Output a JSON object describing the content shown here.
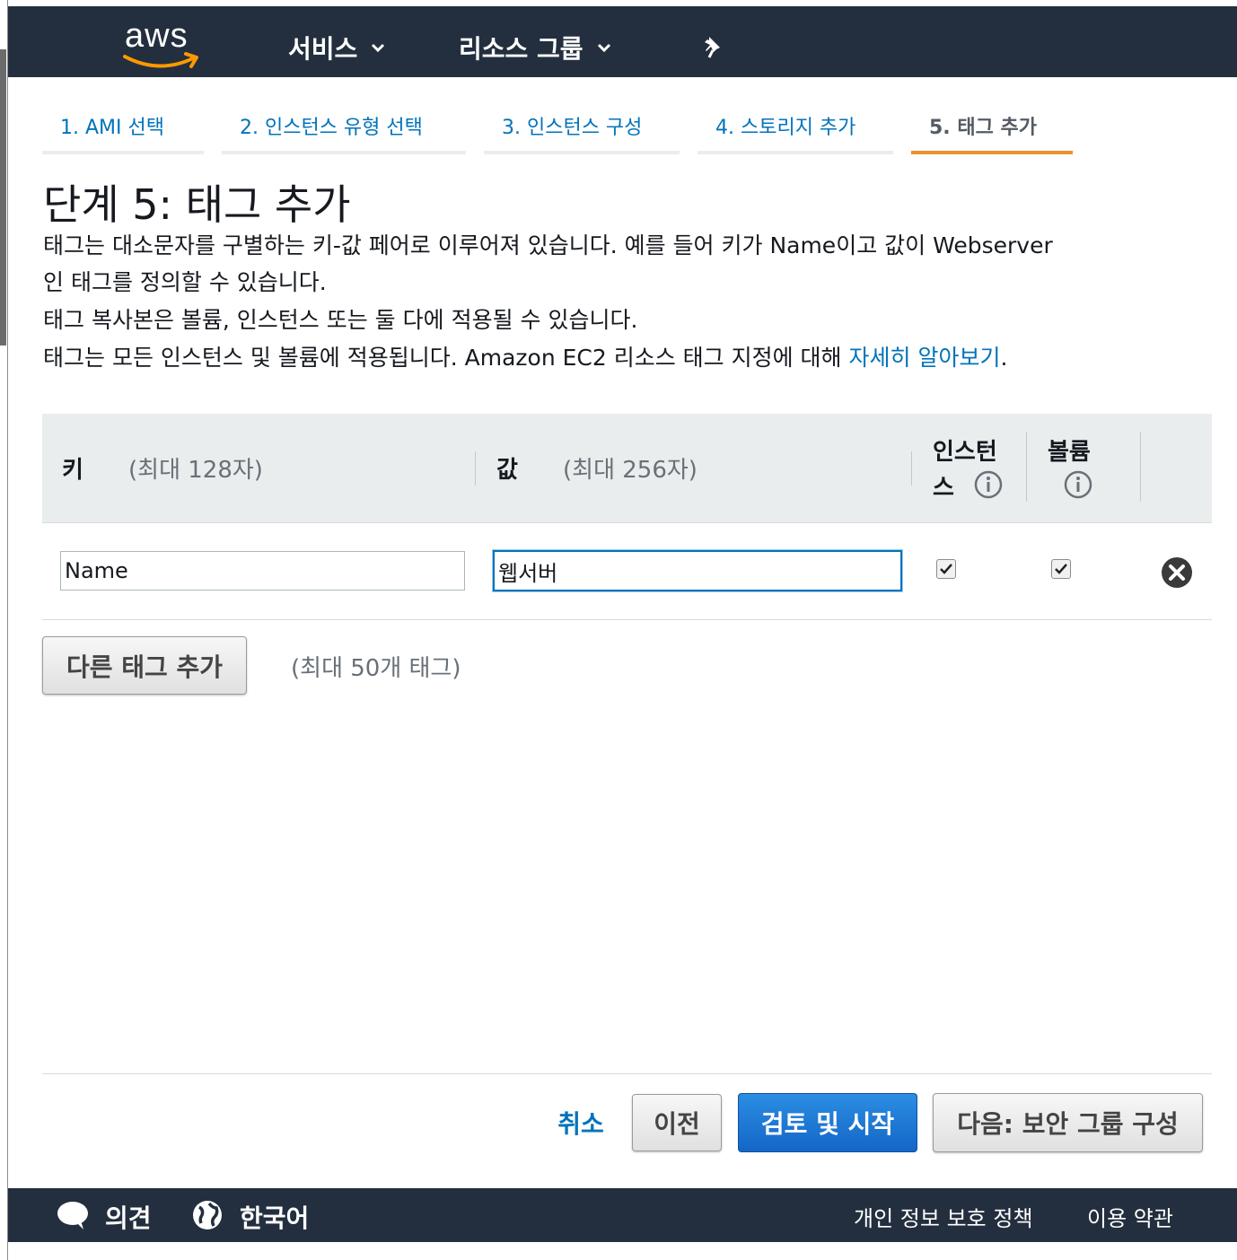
{
  "nav": {
    "logo_text": "aws",
    "services_label": "서비스",
    "resource_groups_label": "리소스 그룹"
  },
  "steps": [
    {
      "label": "1. AMI 선택"
    },
    {
      "label": "2. 인스턴스 유형 선택"
    },
    {
      "label": "3. 인스턴스 구성"
    },
    {
      "label": "4. 스토리지 추가"
    },
    {
      "label": "5. 태그 추가"
    }
  ],
  "page": {
    "title": "단계 5: 태그 추가",
    "desc_line1": "태그는 대소문자를 구별하는 키-값 페어로 이루어져 있습니다. 예를 들어 키가 Name이고 값이 Webserver",
    "desc_line2": "인 태그를 정의할 수 있습니다.",
    "desc_line3": "태그 복사본은 볼륨, 인스턴스 또는 둘 다에 적용될 수 있습니다.",
    "desc_line4": "태그는 모든 인스턴스 및 볼륨에 적용됩니다. Amazon EC2 리소스 태그 지정에 대해 ",
    "learn_more": "자세히 알아보기",
    "period": "."
  },
  "table": {
    "key_header": "키",
    "key_hint": "(최대 128자)",
    "value_header": "값",
    "value_hint": "(최대 256자)",
    "instances_header_1": "인스턴",
    "instances_header_2": "스",
    "volumes_header": "볼륨",
    "rows": [
      {
        "key": "Name",
        "value": "웹서버",
        "instances": true,
        "volumes": true
      }
    ]
  },
  "add_tag": {
    "button": "다른 태그 추가",
    "hint": "(최대 50개 태그)"
  },
  "actions": {
    "cancel": "취소",
    "previous": "이전",
    "review_launch": "검토 및 시작",
    "next": "다음: 보안 그룹 구성"
  },
  "footer": {
    "feedback": "의견",
    "language": "한국어",
    "privacy": "개인 정보 보호 정책",
    "terms": "이용 약관"
  },
  "colors": {
    "nav_bg": "#232f3e",
    "link": "#0073bb",
    "active_tab": "#ec912d",
    "primary_button": "#1466c7"
  }
}
